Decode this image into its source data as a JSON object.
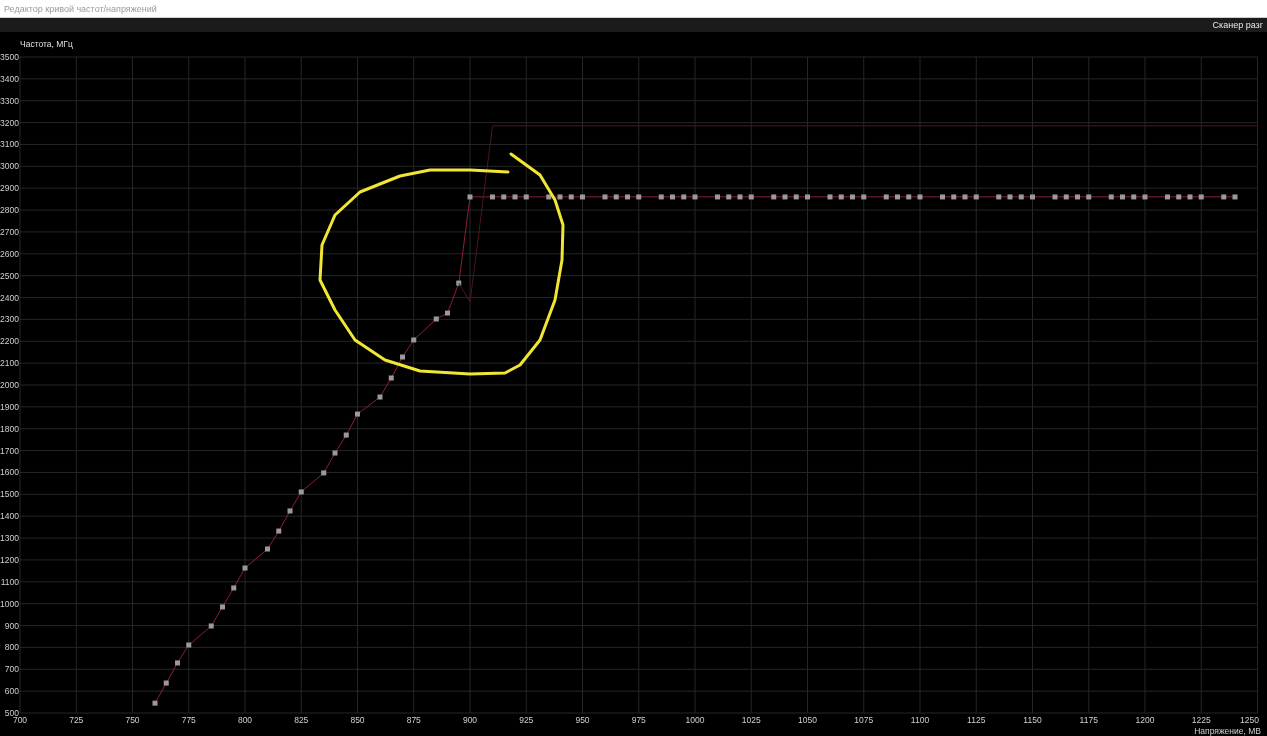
{
  "window": {
    "title": "Редактор кривой частот/напряжений"
  },
  "toolbar": {
    "scanner_button": "Сканер разг"
  },
  "chart_data": {
    "type": "line",
    "ylabel": "Частота, МГц",
    "xlabel": "Напряжение, МВ",
    "xlim": [
      700,
      1250
    ],
    "ylim": [
      500,
      3500
    ],
    "xticks": [
      700,
      725,
      750,
      775,
      800,
      825,
      850,
      875,
      900,
      925,
      950,
      975,
      1000,
      1025,
      1050,
      1075,
      1100,
      1125,
      1150,
      1175,
      1200,
      1225,
      1250
    ],
    "yticks": [
      500,
      600,
      700,
      800,
      900,
      1000,
      1100,
      1200,
      1300,
      1400,
      1500,
      1600,
      1700,
      1800,
      1900,
      2000,
      2100,
      2200,
      2300,
      2400,
      2500,
      2600,
      2700,
      2800,
      2900,
      3000,
      3100,
      3200,
      3300,
      3400,
      3500
    ],
    "series": [
      {
        "color": "#8c2030",
        "marker": "square",
        "x": [
          760,
          765,
          770,
          775,
          785,
          790,
          795,
          800,
          810,
          815,
          820,
          825,
          835,
          840,
          845,
          850,
          860,
          865,
          870,
          875,
          885,
          890,
          895,
          900,
          910,
          915,
          920,
          925,
          935,
          940,
          945,
          950,
          960,
          965,
          970,
          975,
          985,
          990,
          995,
          1000,
          1010,
          1015,
          1020,
          1025,
          1035,
          1040,
          1045,
          1050,
          1060,
          1065,
          1070,
          1075,
          1085,
          1090,
          1095,
          1100,
          1110,
          1115,
          1120,
          1125,
          1135,
          1140,
          1145,
          1150,
          1160,
          1165,
          1170,
          1175,
          1185,
          1190,
          1195,
          1200,
          1210,
          1215,
          1220,
          1225,
          1235,
          1240
        ],
        "values": [
          545,
          637,
          729,
          811,
          898,
          985,
          1072,
          1163,
          1250,
          1332,
          1424,
          1511,
          1598,
          1689,
          1771,
          1867,
          1945,
          2032,
          2128,
          2206,
          2302,
          2329,
          2466,
          2860,
          2860,
          2860,
          2860,
          2860,
          2860,
          2860,
          2860,
          2860,
          2860,
          2860,
          2860,
          2860,
          2860,
          2860,
          2860,
          2860,
          2860,
          2860,
          2860,
          2860,
          2860,
          2860,
          2860,
          2860,
          2860,
          2860,
          2860,
          2860,
          2860,
          2860,
          2860,
          2860,
          2860,
          2860,
          2860,
          2860,
          2860,
          2860,
          2860,
          2860,
          2860,
          2860,
          2860,
          2860,
          2860,
          2860,
          2860,
          2860,
          2860,
          2860,
          2860,
          2860,
          2860,
          2860
        ]
      },
      {
        "color": "#4a1820",
        "x": [
          895,
          900,
          910,
          1250
        ],
        "values": [
          2466,
          2380,
          3185,
          3185
        ]
      }
    ],
    "grid": true
  },
  "markup": [
    {
      "kind": "freehand-circle",
      "color": "#f2e634"
    }
  ]
}
